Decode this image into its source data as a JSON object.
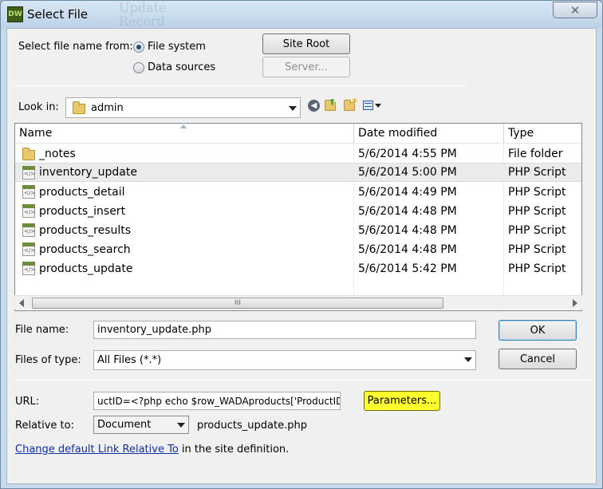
{
  "window": {
    "title": "Select File",
    "app_icon_text": "DW",
    "background_text": "Update\nRecord",
    "close_symbol": "✕"
  },
  "source": {
    "label": "Select file name from:",
    "options": [
      "File system",
      "Data sources"
    ],
    "selected": "File system",
    "site_root_button": "Site Root",
    "server_button": "Server..."
  },
  "look_in": {
    "label": "Look in:",
    "value": "admin",
    "icons": [
      "back-icon",
      "up-folder-icon",
      "new-folder-icon",
      "view-menu-icon"
    ]
  },
  "file_list": {
    "columns": [
      "Name",
      "Date modified",
      "Type"
    ],
    "rows": [
      {
        "name": "_notes",
        "date": "5/6/2014 4:55 PM",
        "type": "File folder",
        "icon": "folder-icon",
        "selected": false
      },
      {
        "name": "inventory_update",
        "date": "5/6/2014 5:00 PM",
        "type": "PHP Script",
        "icon": "php-file-icon",
        "selected": true
      },
      {
        "name": "products_detail",
        "date": "5/6/2014 4:49 PM",
        "type": "PHP Script",
        "icon": "php-file-icon",
        "selected": false
      },
      {
        "name": "products_insert",
        "date": "5/6/2014 4:48 PM",
        "type": "PHP Script",
        "icon": "php-file-icon",
        "selected": false
      },
      {
        "name": "products_results",
        "date": "5/6/2014 4:48 PM",
        "type": "PHP Script",
        "icon": "php-file-icon",
        "selected": false
      },
      {
        "name": "products_search",
        "date": "5/6/2014 4:48 PM",
        "type": "PHP Script",
        "icon": "php-file-icon",
        "selected": false
      },
      {
        "name": "products_update",
        "date": "5/6/2014 5:42 PM",
        "type": "PHP Script",
        "icon": "php-file-icon",
        "selected": false
      }
    ],
    "scroll_grip": "III"
  },
  "file_name": {
    "label": "File name:",
    "value": "inventory_update.php"
  },
  "files_of_type": {
    "label": "Files of type:",
    "value": "All Files (*.*)"
  },
  "buttons": {
    "ok": "OK",
    "cancel": "Cancel",
    "parameters": "Parameters..."
  },
  "url": {
    "label": "URL:",
    "value": "uctID=<?php echo $row_WADAproducts['ProductID"
  },
  "relative_to": {
    "label": "Relative to:",
    "value": "Document",
    "file": "products_update.php"
  },
  "footer": {
    "link": "Change default Link Relative To",
    "text": " in the site definition."
  },
  "colors": {
    "parameters_highlight": "#ffff30",
    "link": "#0b2fa8",
    "selected_row": "#ebebeb"
  }
}
